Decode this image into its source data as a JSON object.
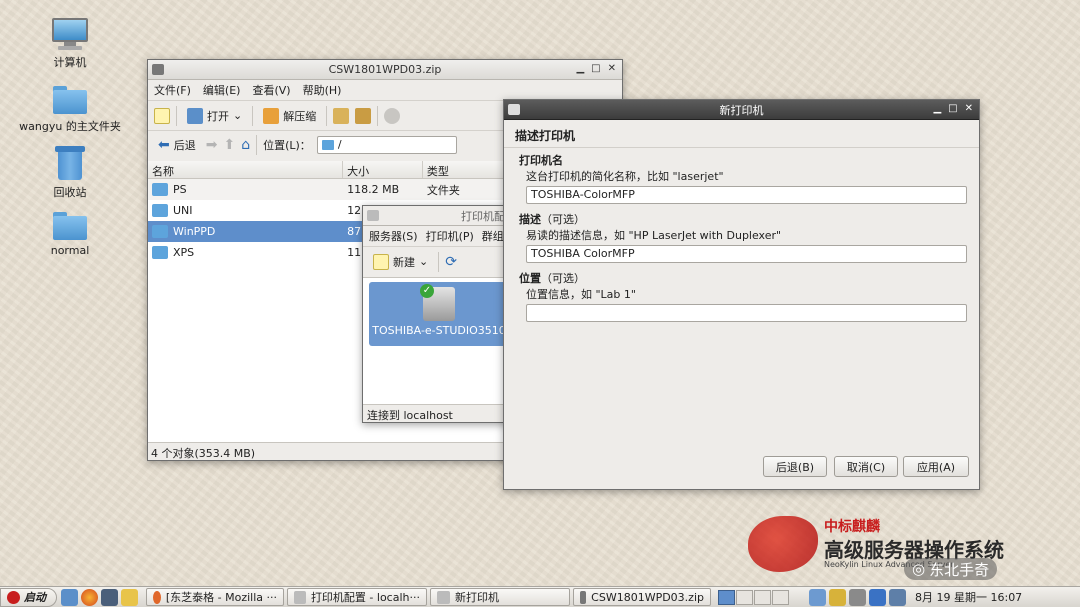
{
  "desktop": {
    "icons": [
      {
        "label": "计算机"
      },
      {
        "label": "wangyu 的主文件夹"
      },
      {
        "label": "回收站"
      },
      {
        "label": "normal"
      }
    ]
  },
  "archive_window": {
    "title": "CSW1801WPD03.zip",
    "menu": [
      "文件(F)",
      "编辑(E)",
      "查看(V)",
      "帮助(H)"
    ],
    "toolbar": {
      "open": "打开",
      "extract": "解压缩"
    },
    "nav": {
      "back": "后退",
      "location_label": "位置(L)：",
      "location_value": "/"
    },
    "columns": [
      "名称",
      "大小",
      "类型"
    ],
    "rows": [
      {
        "name": "PS",
        "size": "118.2 MB",
        "type": "文件夹"
      },
      {
        "name": "UNI",
        "size": "12",
        "type": ""
      },
      {
        "name": "WinPPD",
        "size": "87",
        "type": ""
      },
      {
        "name": "XPS",
        "size": "11",
        "type": ""
      }
    ],
    "status": "4 个对象(353.4 MB)"
  },
  "printer_config_window": {
    "title": "打印机配",
    "menu": [
      "服务器(S)",
      "打印机(P)",
      "群组"
    ],
    "toolbar": {
      "new": "新建"
    },
    "printer_name": "TOSHIBA-e-STUDIO3510",
    "status": "连接到 localhost"
  },
  "new_printer_dialog": {
    "title": "新打印机",
    "heading": "描述打印机",
    "name_section": {
      "label": "打印机名",
      "hint": "这台打印机的简化名称，比如 \"laserjet\"",
      "value": "TOSHIBA-ColorMFP"
    },
    "desc_section": {
      "label": "描述",
      "optional": "（可选）",
      "hint": "易读的描述信息，如 \"HP LaserJet with Duplexer\"",
      "value": "TOSHIBA ColorMFP"
    },
    "loc_section": {
      "label": "位置",
      "optional": "（可选）",
      "hint": "位置信息，如 \"Lab 1\"",
      "value": ""
    },
    "buttons": {
      "back": "后退(B)",
      "cancel": "取消(C)",
      "apply": "应用(A)"
    }
  },
  "watermark": {
    "brand": "中标麒麟",
    "title": "高级服务器操作系统",
    "subtitle": "NeoKylin Linux Advanced Server",
    "wechat": "东北手奇"
  },
  "taskbar": {
    "start": "启动",
    "tasks": [
      {
        "label": "[东芝泰格 - Mozilla ···"
      },
      {
        "label": "打印机配置 - localh···"
      },
      {
        "label": "新打印机"
      },
      {
        "label": "CSW1801WPD03.zip"
      }
    ],
    "clock": "8月 19 星期一 16:07"
  },
  "colors": {
    "selection": "#5e8ecb",
    "titlebar": "#dcdad6",
    "desktop": "#e8e0d2",
    "brand_red": "#c81e1e"
  }
}
